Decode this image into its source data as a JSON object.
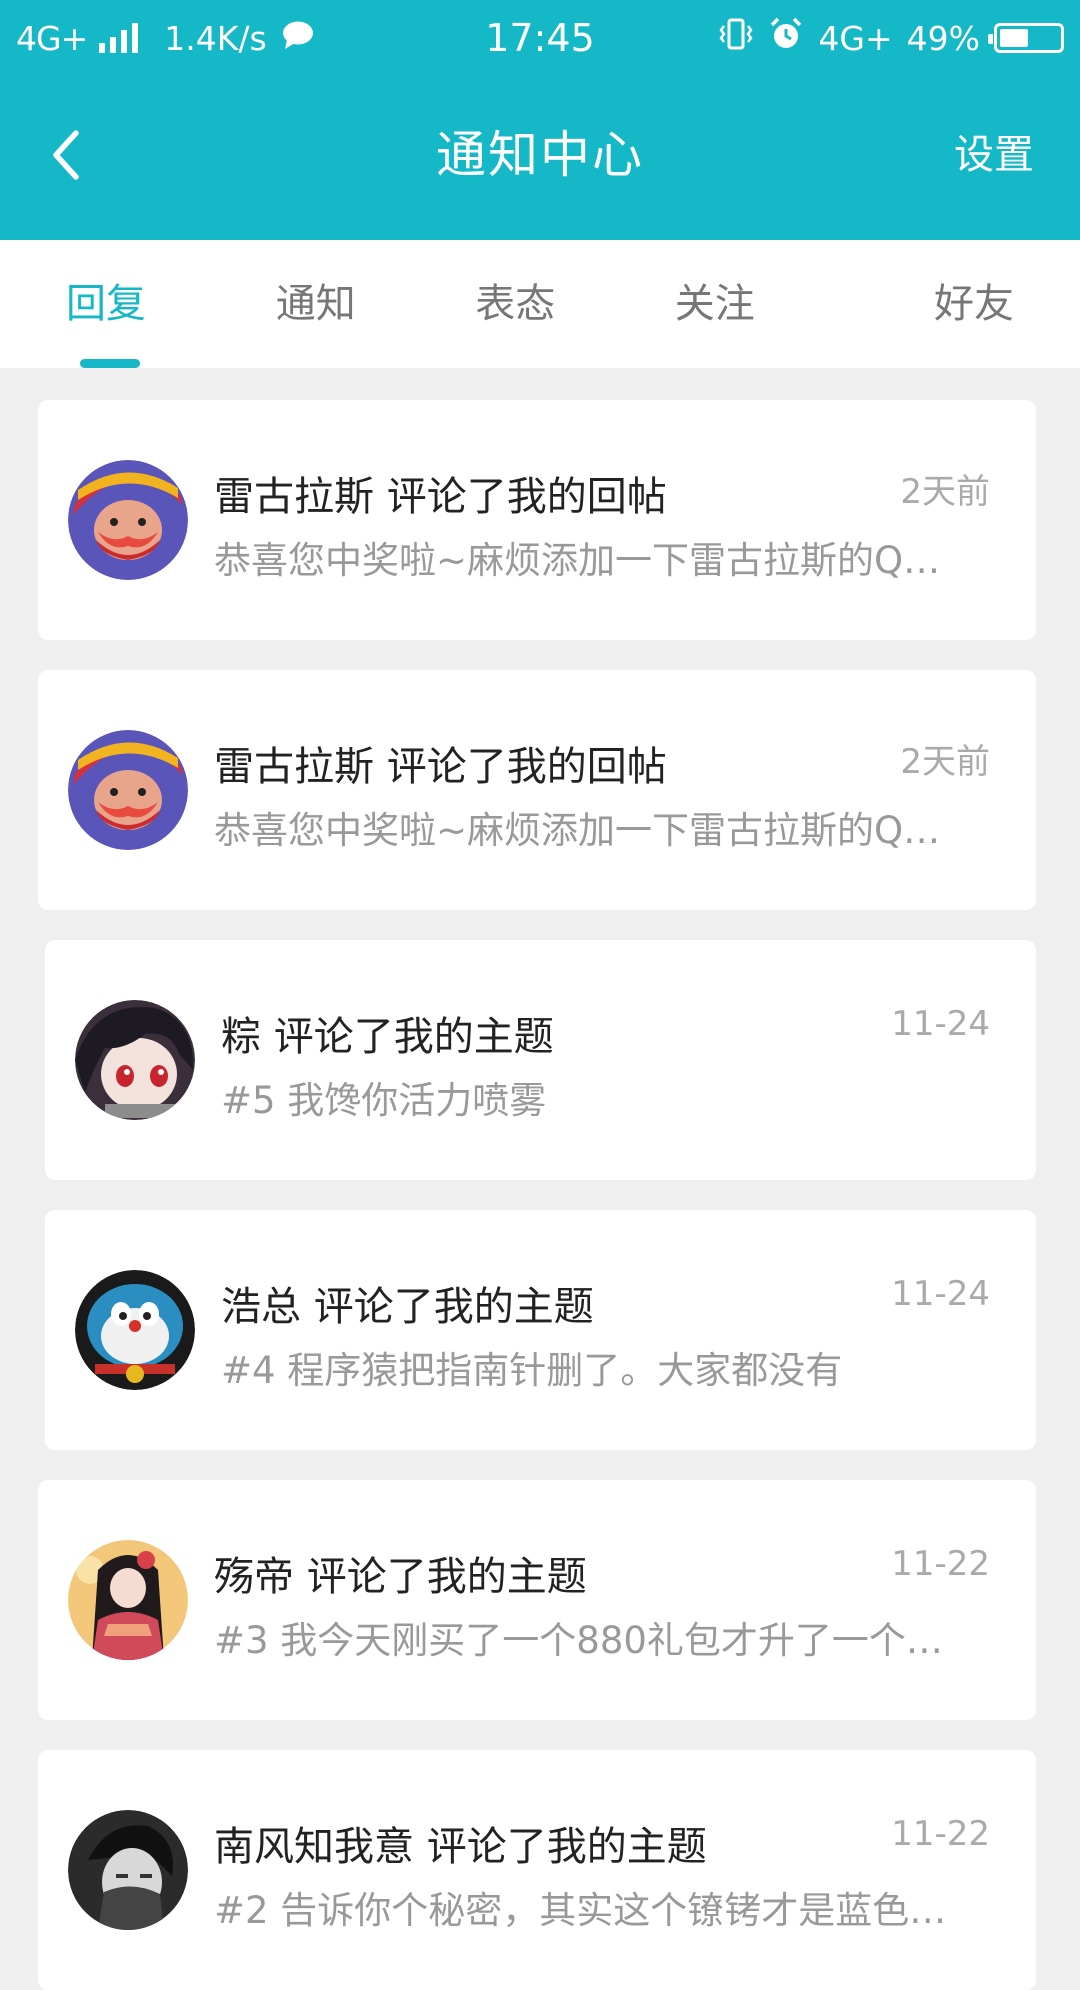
{
  "status_bar": {
    "network": "4G+",
    "speed": "1.4K/s",
    "time": "17:45",
    "network_right": "4G+",
    "battery": "49%",
    "battery_level": 0.49
  },
  "header": {
    "title": "通知中心",
    "settings_label": "设置",
    "color": "#14b8c6"
  },
  "tabs": [
    {
      "label": "回复",
      "active": true
    },
    {
      "label": "通知",
      "active": false
    },
    {
      "label": "表态",
      "active": false
    },
    {
      "label": "关注",
      "active": false
    },
    {
      "label": "好友",
      "active": false
    }
  ],
  "notifications": [
    {
      "user": "雷古拉斯",
      "title": "雷古拉斯 评论了我的回帖",
      "preview": "恭喜您中奖啦~麻烦添加一下雷古拉斯的Q…",
      "time": "2天前",
      "avatar": "pirate-avatar"
    },
    {
      "user": "雷古拉斯",
      "title": "雷古拉斯 评论了我的回帖",
      "preview": "恭喜您中奖啦~麻烦添加一下雷古拉斯的Q…",
      "time": "2天前",
      "avatar": "pirate-avatar"
    },
    {
      "user": "粽",
      "title": "粽 评论了我的主题",
      "preview": "#5 我馋你活力喷雾",
      "time": "11-24",
      "avatar": "anime-girl-avatar"
    },
    {
      "user": "浩总",
      "title": "浩总 评论了我的主题",
      "preview": "#4 程序猿把指南针删了。大家都没有",
      "time": "11-24",
      "avatar": "blue-cat-avatar"
    },
    {
      "user": "殇帝",
      "title": "殇帝 评论了我的主题",
      "preview": "#3 我今天刚买了一个880礼包才升了一个…",
      "time": "11-22",
      "avatar": "kimono-girl-avatar"
    },
    {
      "user": "南风知我意",
      "title": "南风知我意 评论了我的主题",
      "preview": "#2 告诉你个秘密，其实这个镣铐才是蓝色…",
      "time": "11-22",
      "avatar": "bw-portrait-avatar"
    }
  ]
}
